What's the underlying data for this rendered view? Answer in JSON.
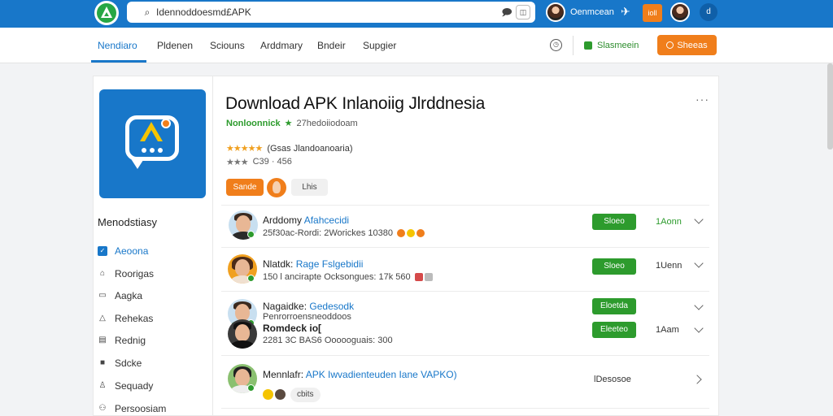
{
  "topbar": {
    "search_text": "Idennoddoesmd£APK",
    "user_name": "Oenmcean",
    "orange_btn": "ioll",
    "circle_btn": "d"
  },
  "nav": {
    "items": [
      "Nendiaro",
      "Pldenen",
      "Sciouns",
      "Arddmary",
      "Bndeir",
      "Supgier"
    ],
    "green_btn": "Slasmeein",
    "orange_btn": "Sheeas"
  },
  "app": {
    "title": "Download APK Inlanoiig Jlrddnesia",
    "developer": "Nonloonnick",
    "meta": "27hedoiiodoam",
    "rating_text": "(Gsas Jlandoanoaria)",
    "rating2_text": "C39 · 456",
    "pill_orange": "Sande",
    "pill_grey": "Lhis"
  },
  "sidebar": {
    "title": "Menodstiasy",
    "items": [
      {
        "label": "Aeoona",
        "icon": "check-square-icon"
      },
      {
        "label": "Roorigas",
        "icon": "home-icon"
      },
      {
        "label": "Aagka",
        "icon": "chat-icon"
      },
      {
        "label": "Rehekas",
        "icon": "bell-icon"
      },
      {
        "label": "Rednig",
        "icon": "message-icon"
      },
      {
        "label": "Sdcke",
        "icon": "square-icon"
      },
      {
        "label": "Sequady",
        "icon": "user-icon"
      },
      {
        "label": "Persoosiam",
        "icon": "people-icon"
      }
    ]
  },
  "reviews": [
    {
      "name": "Arddomy",
      "highlight": "Afahcecidi",
      "meta": "25f30ac-Rordi: 2Worickes 10380",
      "button": "Sloeo",
      "stat": "1Aonn"
    },
    {
      "name": "Nlatdk:",
      "highlight": "Rage Fslgebidii",
      "meta": "150 l ancirapte Ocksongues: 17k  560",
      "button": "Sloeo",
      "stat": "1Uenn"
    },
    {
      "name": "Nagaidke:",
      "highlight": "Gedesodk",
      "meta": "Penrorroensneoddoos",
      "button": "Eloetda",
      "stat": ""
    },
    {
      "name": "Romdeck",
      "highlight": "io[",
      "meta": "2281 3C BAS6 Oooooguais: 300",
      "button": "Eleeteo",
      "stat": "1Aam"
    },
    {
      "name": "Mennlafr:",
      "highlight": "APK Iwvadienteuden Iane VAPKO)",
      "meta": "",
      "chip": "cbits",
      "stat": "lDesosoe"
    }
  ]
}
